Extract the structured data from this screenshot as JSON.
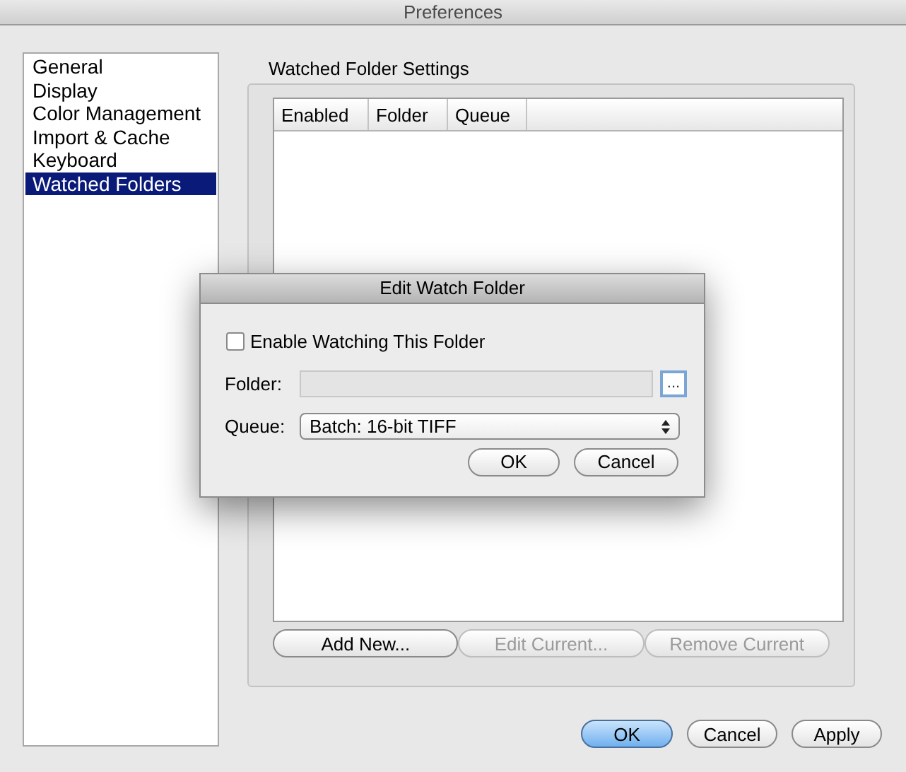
{
  "window": {
    "title": "Preferences"
  },
  "sidebar": {
    "items": [
      {
        "label": "General",
        "selected": false
      },
      {
        "label": "Display",
        "selected": false
      },
      {
        "label": "Color Management",
        "selected": false
      },
      {
        "label": "Import & Cache",
        "selected": false
      },
      {
        "label": "Keyboard",
        "selected": false
      },
      {
        "label": "Watched Folders",
        "selected": true
      }
    ]
  },
  "group": {
    "title": "Watched Folder Settings",
    "table": {
      "columns": [
        "Enabled",
        "Folder",
        "Queue"
      ]
    },
    "buttons": [
      {
        "label": "Add New...",
        "disabled": false
      },
      {
        "label": "Edit Current...",
        "disabled": true
      },
      {
        "label": "Remove Current",
        "disabled": true
      }
    ]
  },
  "footer_buttons": [
    {
      "label": "OK",
      "default": true
    },
    {
      "label": "Cancel",
      "default": false
    },
    {
      "label": "Apply",
      "default": false
    }
  ],
  "dialog": {
    "title": "Edit Watch Folder",
    "enable_checkbox": {
      "label": "Enable Watching This Folder",
      "checked": false
    },
    "folder": {
      "label": "Folder:",
      "disabled": true,
      "browse_label": "..."
    },
    "queue": {
      "label": "Queue:",
      "value": "Batch: 16-bit TIFF"
    },
    "buttons": [
      {
        "label": "OK",
        "default": false
      },
      {
        "label": "Cancel",
        "default": false
      }
    ]
  }
}
